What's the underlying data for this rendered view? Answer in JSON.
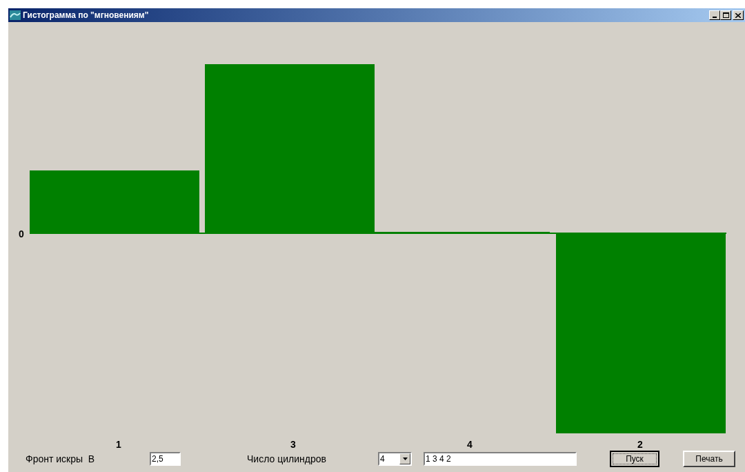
{
  "window": {
    "title": "Гистограмма по \"мгновениям\""
  },
  "chart": {
    "zero_label": "0",
    "category_labels": [
      "1",
      "3",
      "4",
      "2"
    ]
  },
  "controls": {
    "spark_label": "Фронт искры  В",
    "spark_value": "2,5",
    "cylinders_label": "Число цилиндров",
    "cylinders_value": "4",
    "order_value": "1 3 4 2",
    "buttons": [
      {
        "label": "Пуск",
        "default": true
      },
      {
        "label": "Печать",
        "default": false
      }
    ]
  }
}
